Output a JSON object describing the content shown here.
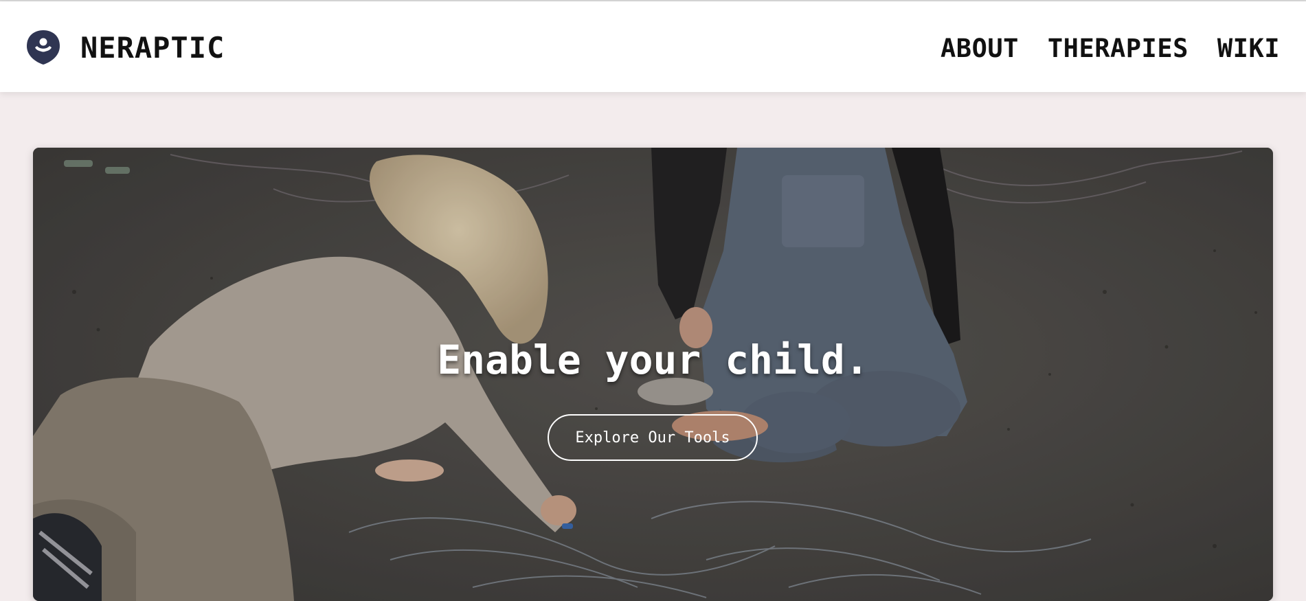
{
  "brand": {
    "name": "NERAPTIC",
    "logo_icon": "shield-face-icon",
    "logo_color": "#2f3552"
  },
  "nav": {
    "items": [
      {
        "label": "ABOUT"
      },
      {
        "label": "THERAPIES"
      },
      {
        "label": "WIKI"
      }
    ]
  },
  "hero": {
    "title": "Enable your child.",
    "cta_label": "Explore Our Tools",
    "image_subject": "two children drawing with chalk on pavement"
  },
  "colors": {
    "page_background": "#f3eced",
    "header_background": "#ffffff",
    "text": "#111111"
  }
}
